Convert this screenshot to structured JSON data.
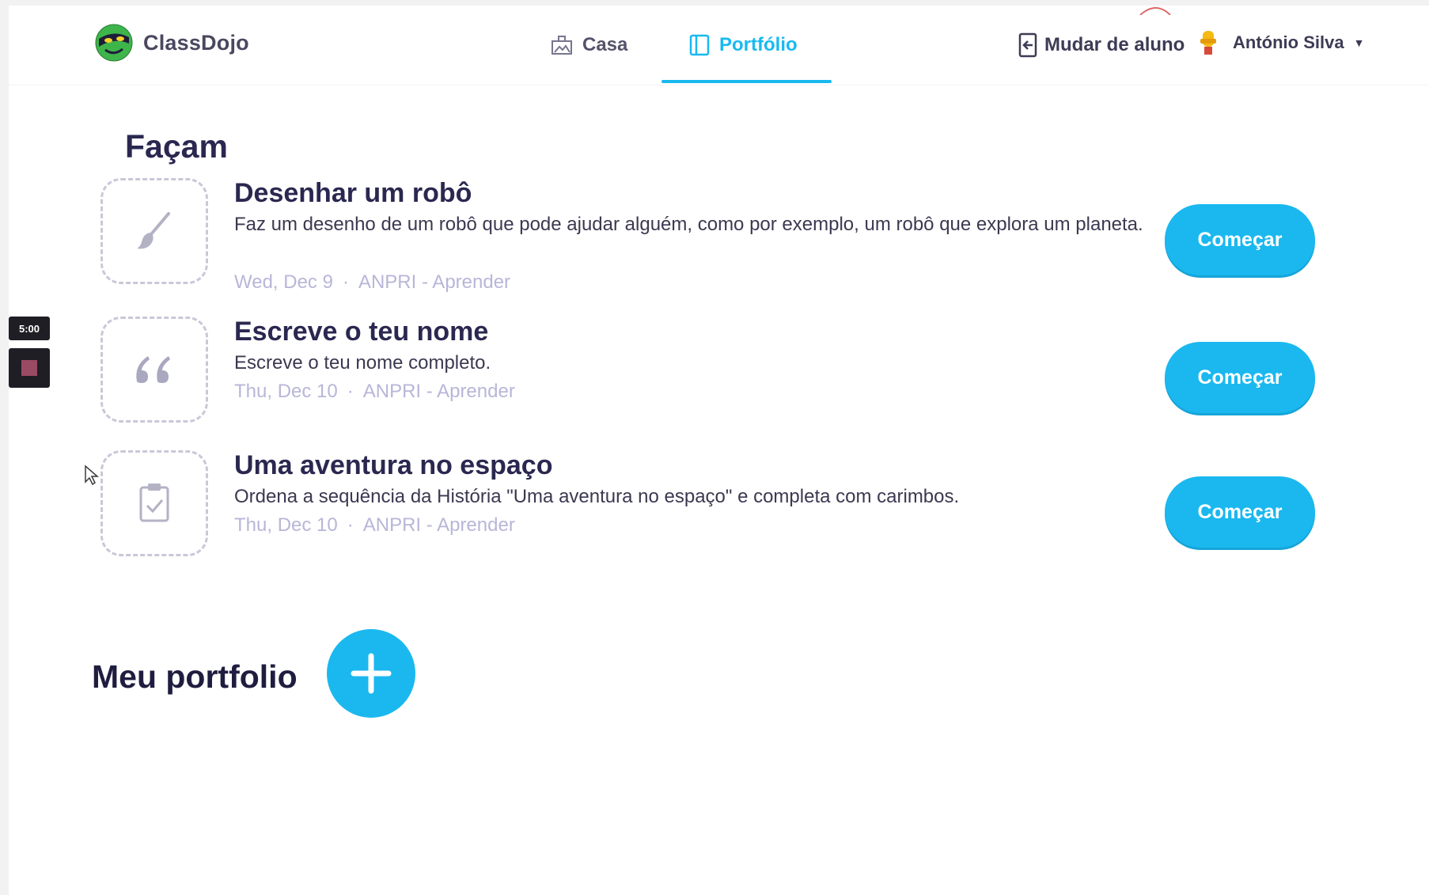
{
  "header": {
    "app_name": "ClassDojo",
    "nav": {
      "home_label": "Casa",
      "portfolio_label": "Portfólio",
      "active_tab": "Portfólio"
    },
    "switch_student_label": "Mudar de aluno",
    "user_name": "António Silva"
  },
  "recorder": {
    "time": "5:00"
  },
  "todo": {
    "title": "Façam",
    "tasks": [
      {
        "title": "Desenhar um robô",
        "description": "Faz um desenho de um robô que pode ajudar alguém, como por exemplo, um robô que explora um planeta.",
        "date": "Wed, Dec 9",
        "class": "ANPRI - Aprender",
        "button": "Começar",
        "icon": "paintbrush-icon"
      },
      {
        "title": "Escreve o teu nome",
        "description": "Escreve o teu nome completo.",
        "date": "Thu, Dec 10",
        "class": "ANPRI - Aprender",
        "button": "Começar",
        "icon": "quote-icon"
      },
      {
        "title": "Uma aventura no espaço",
        "description": "Ordena a sequência da História \"Uma aventura no espaço\" e completa com carimbos.",
        "date": "Thu, Dec 10",
        "class": "ANPRI - Aprender",
        "button": "Começar",
        "icon": "clipboard-check-icon"
      }
    ]
  },
  "portfolio": {
    "title": "Meu portfolio",
    "add_icon": "plus-icon"
  },
  "colors": {
    "accent": "#1ab8ef",
    "title": "#2a2850",
    "meta": "#b8b6d8"
  }
}
